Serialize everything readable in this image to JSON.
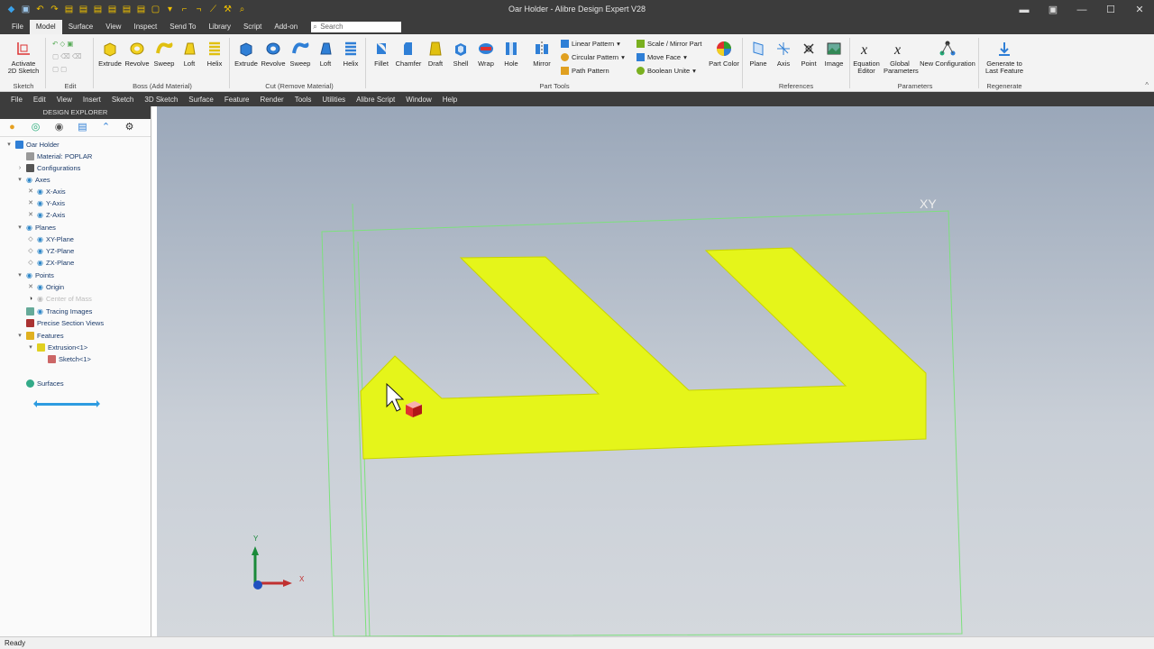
{
  "window": {
    "title": "Oar Holder - Alibre Design Expert V28",
    "controls": [
      "minimize",
      "maximize",
      "close"
    ]
  },
  "ribbon_tabs": [
    {
      "label": "File",
      "active": false
    },
    {
      "label": "Model",
      "active": true
    },
    {
      "label": "Surface",
      "active": false
    },
    {
      "label": "View",
      "active": false
    },
    {
      "label": "Inspect",
      "active": false
    },
    {
      "label": "Send To",
      "active": false
    },
    {
      "label": "Library",
      "active": false
    },
    {
      "label": "Script",
      "active": false
    },
    {
      "label": "Add-on",
      "active": false
    }
  ],
  "search": {
    "placeholder": "Search"
  },
  "ribbon": {
    "sketch_group": {
      "label": "Sketch",
      "activate": "Activate",
      "activate2": "2D Sketch"
    },
    "edit_group": {
      "label": "Edit"
    },
    "boss_group": {
      "label": "Boss (Add Material)",
      "buttons": [
        "Extrude",
        "Revolve",
        "Sweep",
        "Loft",
        "Helix"
      ]
    },
    "cut_group": {
      "label": "Cut (Remove Material)",
      "buttons": [
        "Extrude",
        "Revolve",
        "Sweep",
        "Loft",
        "Helix"
      ]
    },
    "part_tools": {
      "label": "Part Tools",
      "buttons": [
        "Fillet",
        "Chamfer",
        "Draft",
        "Shell",
        "Wrap",
        "Hole",
        "Mirror"
      ],
      "small": [
        "Linear Pattern",
        "Circular Pattern",
        "Path Pattern",
        "Scale / Mirror Part",
        "Move Face",
        "Boolean Unite"
      ],
      "part_color": "Part Color"
    },
    "references": {
      "label": "References",
      "buttons": [
        "Plane",
        "Axis",
        "Point",
        "Image"
      ]
    },
    "parameters": {
      "label": "Parameters",
      "equation": "Equation",
      "equation2": "Editor",
      "global": "Global",
      "global2": "Parameters",
      "new_config": "New Configuration"
    },
    "regenerate": {
      "label": "Regenerate",
      "gen": "Generate to",
      "gen2": "Last Feature"
    }
  },
  "menu": [
    "File",
    "Edit",
    "View",
    "Insert",
    "Sketch",
    "3D Sketch",
    "Surface",
    "Feature",
    "Render",
    "Tools",
    "Utilities",
    "Alibre Script",
    "Window",
    "Help"
  ],
  "explorer": {
    "title": "DESIGN EXPLORER",
    "tree": [
      {
        "label": "Oar Holder"
      },
      {
        "label": "Material: POPLAR"
      },
      {
        "label": "Configurations"
      },
      {
        "label": "Axes"
      },
      {
        "label": "X-Axis"
      },
      {
        "label": "Y-Axis"
      },
      {
        "label": "Z-Axis"
      },
      {
        "label": "Planes"
      },
      {
        "label": "XY-Plane"
      },
      {
        "label": "YZ-Plane"
      },
      {
        "label": "ZX-Plane"
      },
      {
        "label": "Points"
      },
      {
        "label": "Origin"
      },
      {
        "label": "Center of Mass"
      },
      {
        "label": "Tracing Images"
      },
      {
        "label": "Precise Section Views"
      },
      {
        "label": "Features"
      },
      {
        "label": "Extrusion<1>"
      },
      {
        "label": "Sketch<1>"
      },
      {
        "label": "Surfaces"
      }
    ]
  },
  "viewport": {
    "plane_label": "XY",
    "axis_x_label": "X",
    "axis_y_label": "Y",
    "part_color": "#e5f51a"
  },
  "status": "Ready"
}
